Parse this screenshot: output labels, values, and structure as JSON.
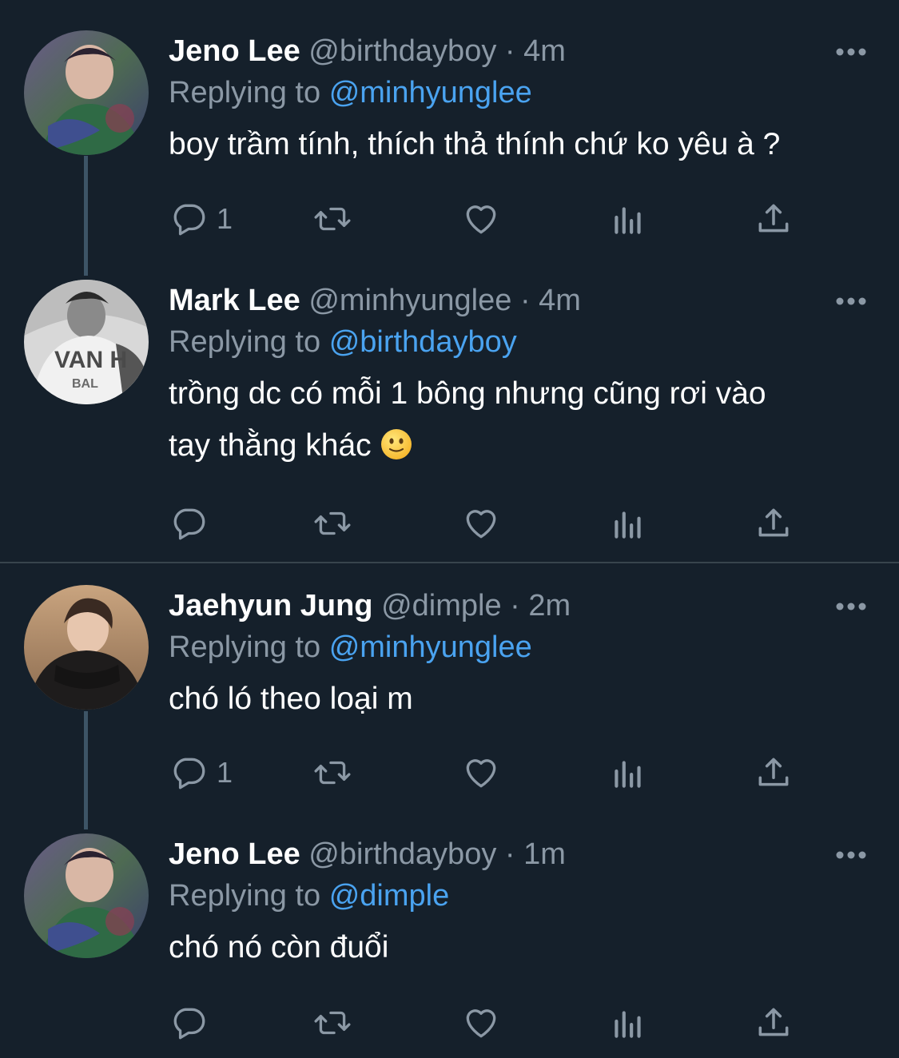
{
  "colors": {
    "background": "#15202b",
    "text": "#ffffff",
    "secondary": "#8b98a5",
    "link": "#4aa3f0",
    "thread_line": "#3d5466"
  },
  "tweets": [
    {
      "name": "Jeno Lee",
      "handle": "@birthdayboy",
      "time": "4m",
      "replying_prefix": "Replying to",
      "replying_to": "@minhyunglee",
      "text_lines": [
        "boy trầm tính, thích thả thính chứ ko yêu à ?"
      ],
      "reply_count": "1",
      "avatar": "avatar-jeno"
    },
    {
      "name": "Mark Lee",
      "handle": "@minhyunglee",
      "time": "4m",
      "replying_prefix": "Replying to",
      "replying_to": "@birthdayboy",
      "text_lines": [
        "trồng dc có mỗi 1 bông nhưng cũng rơi vào",
        "tay thằng khác"
      ],
      "reply_count": "",
      "emoji": "slightly-smiling-face-emoji",
      "avatar": "avatar-mark"
    },
    {
      "name": "Jaehyun Jung",
      "handle": "@dimple",
      "time": "2m",
      "replying_prefix": "Replying to",
      "replying_to": "@minhyunglee",
      "text_lines": [
        "chó ló theo loại m"
      ],
      "reply_count": "1",
      "avatar": "avatar-jaehyun"
    },
    {
      "name": "Jeno Lee",
      "handle": "@birthdayboy",
      "time": "1m",
      "replying_prefix": "Replying to",
      "replying_to": "@dimple",
      "text_lines": [
        "chó nó còn đuổi"
      ],
      "reply_count": "",
      "avatar": "avatar-jeno"
    }
  ],
  "separator": "·",
  "icons": [
    "reply-icon",
    "retweet-icon",
    "like-icon",
    "analytics-icon",
    "share-icon",
    "more-icon"
  ]
}
